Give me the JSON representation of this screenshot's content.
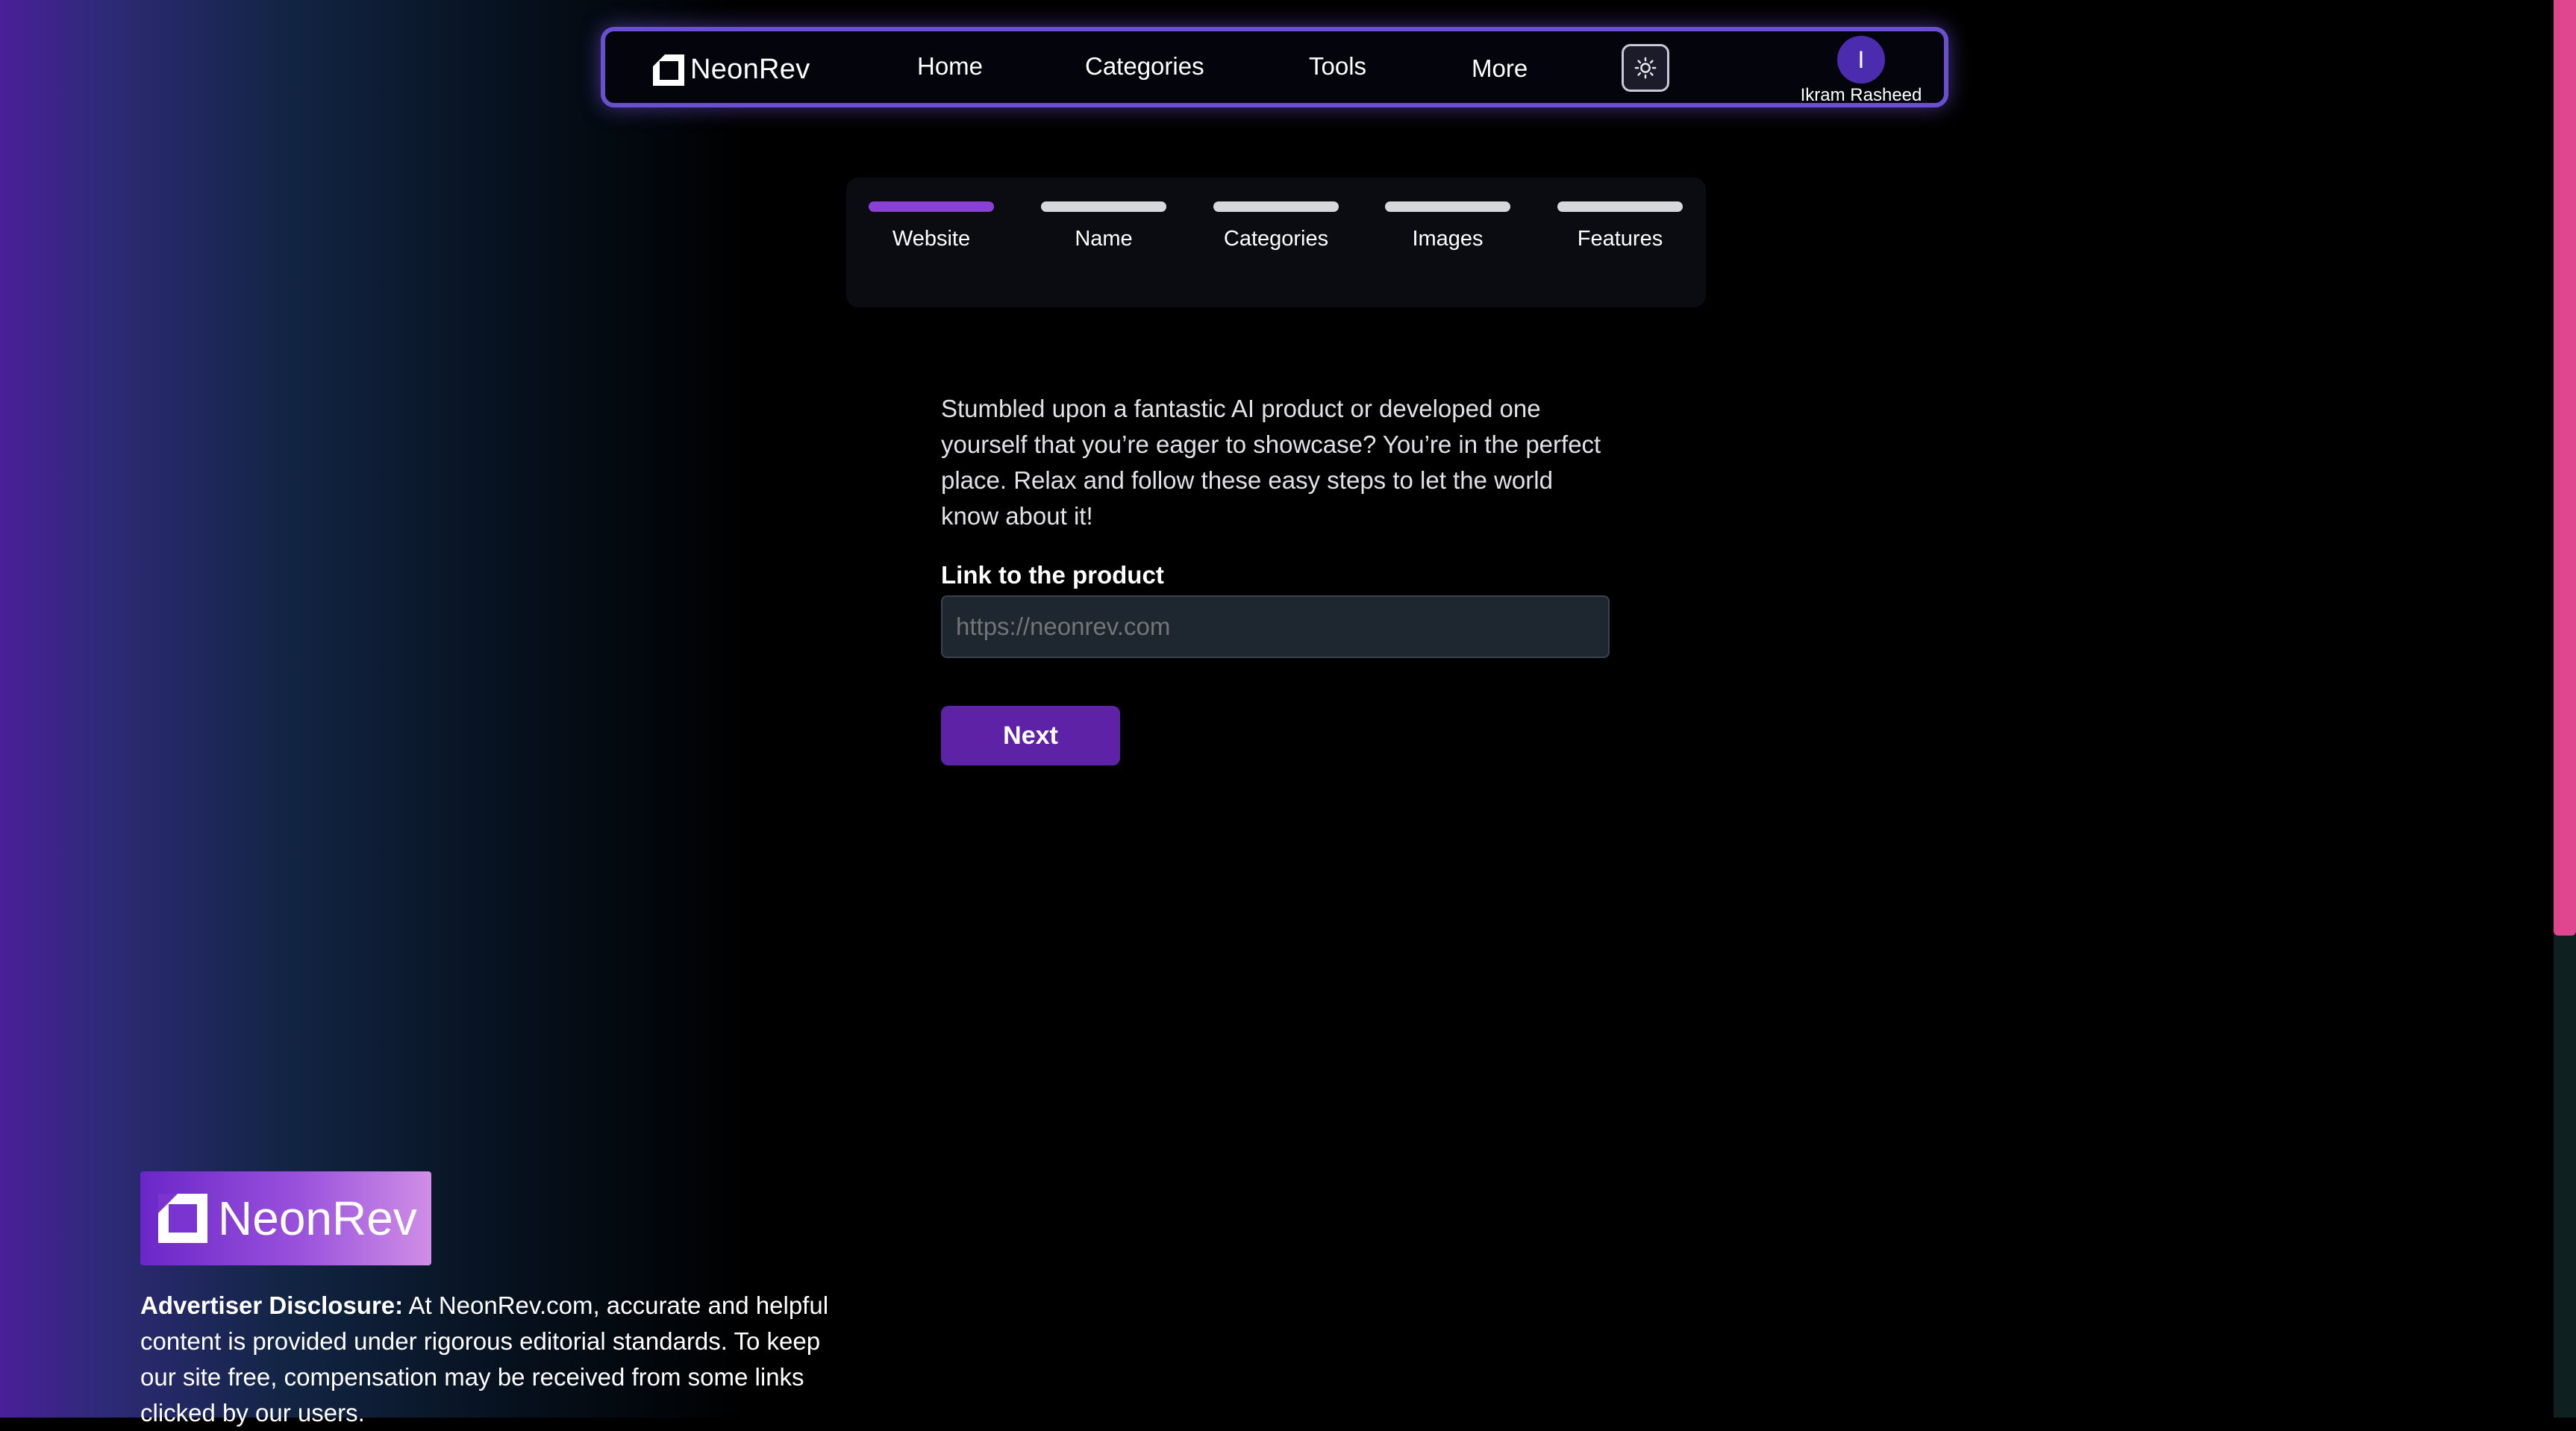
{
  "brand": {
    "name": "NeonRev"
  },
  "nav": {
    "links": [
      "Home",
      "Categories",
      "Tools",
      "More"
    ],
    "theme_icon": "sun-icon",
    "user": {
      "initial": "I",
      "name": "Ikram Rasheed"
    }
  },
  "steps": {
    "items": [
      "Website",
      "Name",
      "Categories",
      "Images",
      "Features"
    ],
    "active_index": 0
  },
  "form": {
    "intro": "Stumbled upon a fantastic AI product or developed one yourself that you’re eager to showcase? You’re in the perfect place. Relax and follow these easy steps to let the world know about it!",
    "link_label": "Link to the product",
    "link_placeholder": "https://neonrev.com",
    "link_value": "",
    "next_label": "Next"
  },
  "footer": {
    "logo_text": "NeonRev",
    "disclosure_title": "Advertiser Disclosure:",
    "disclosure_text": " At NeonRev.com, accurate and helpful content is provided under rigorous editorial standards. To keep our site free, compensation may be received from some links clicked by our users."
  },
  "colors": {
    "accent": "#5d22a6",
    "active_step": "#8a40d6",
    "nav_border": "#6a4fd0",
    "scroll_thumb": "#e0458f"
  }
}
